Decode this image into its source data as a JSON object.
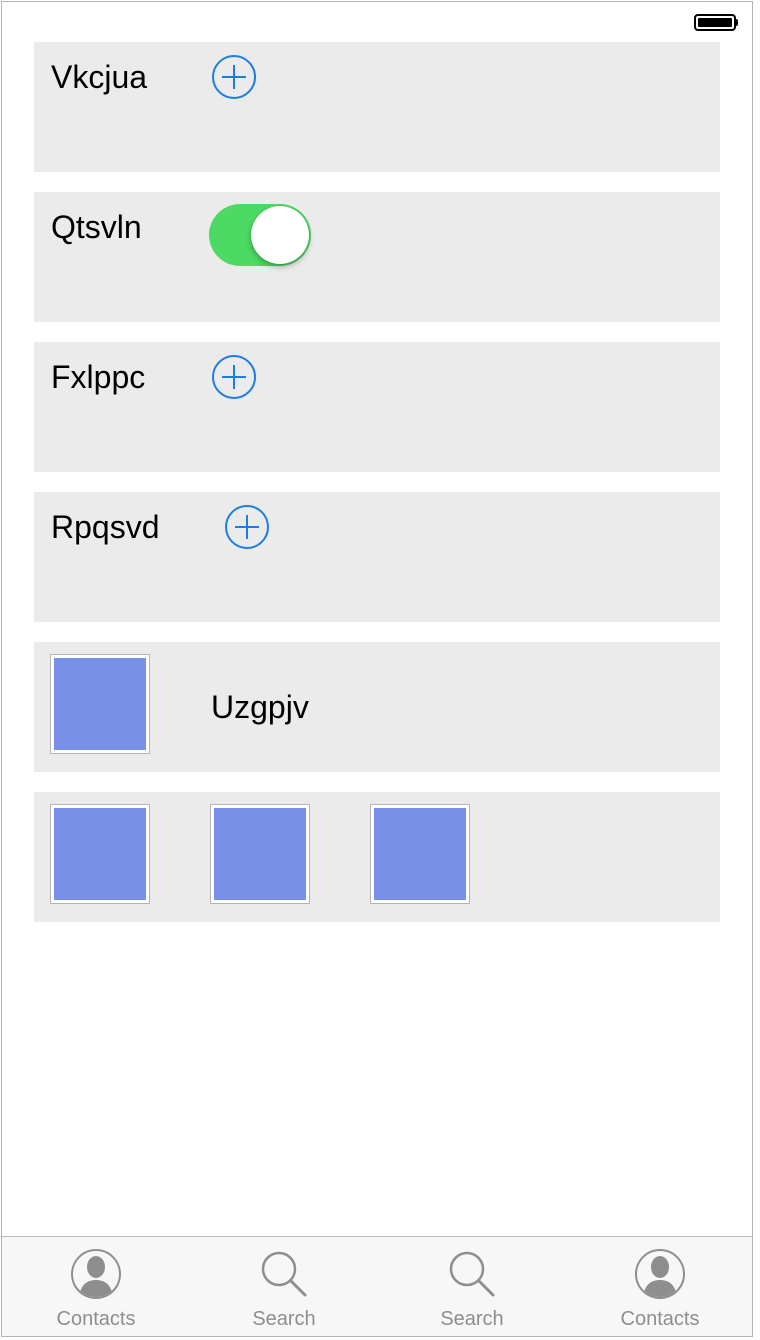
{
  "status_bar": {
    "battery_icon": "battery-full-icon"
  },
  "rows": [
    {
      "label": "Vkcjua",
      "control": "add-button",
      "icon": "plus-circle-icon"
    },
    {
      "label": "Qtsvln",
      "control": "toggle",
      "toggle_on": true
    },
    {
      "label": "Fxlppc",
      "control": "add-button",
      "icon": "plus-circle-icon"
    },
    {
      "label": "Rpqsvd",
      "control": "add-button",
      "icon": "plus-circle-icon"
    }
  ],
  "image_row": {
    "label": "Uzgpjv"
  },
  "image_grid": {
    "count": 3
  },
  "tab_bar": {
    "tabs": [
      {
        "label": "Contacts",
        "icon": "contacts-icon"
      },
      {
        "label": "Search",
        "icon": "search-icon"
      },
      {
        "label": "Search",
        "icon": "search-icon"
      },
      {
        "label": "Contacts",
        "icon": "contacts-icon"
      }
    ]
  },
  "colors": {
    "accent": "#1a7ee6",
    "toggle_on": "#4cd964",
    "card_bg": "#ebebeb",
    "image_fill": "#7890e6",
    "tab_label": "#8e8e8e"
  }
}
